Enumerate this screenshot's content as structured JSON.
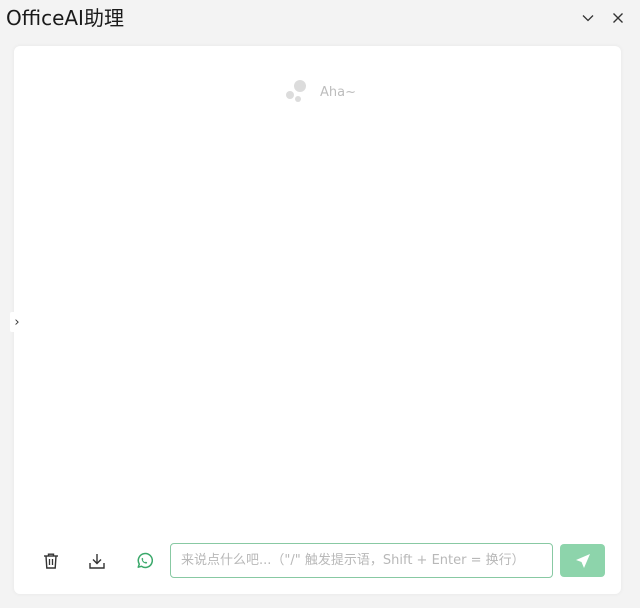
{
  "window": {
    "title": "OfficeAI助理",
    "minimize_icon": "chevron-down-icon",
    "close_icon": "close-icon"
  },
  "chat": {
    "logo_text": "Aha~",
    "expander_glyph": "›"
  },
  "toolbar": {
    "clear_icon": "trash-icon",
    "download_icon": "download-icon",
    "history_icon": "whatsapp-icon"
  },
  "composer": {
    "placeholder": "来说点什么吧...（\"/\" 触发提示语，Shift + Enter = 换行）",
    "value": "",
    "send_icon": "send-icon"
  },
  "colors": {
    "accent": "#3aa86a",
    "send_bg": "#8dd4ab",
    "input_border": "#88c9a3"
  }
}
